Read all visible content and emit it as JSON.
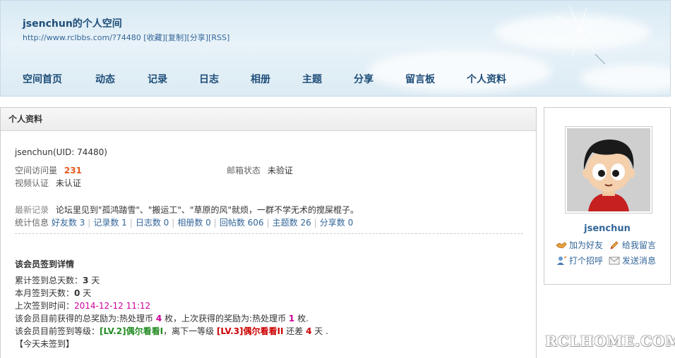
{
  "header": {
    "title": "jsenchun的个人空间",
    "url": "http://www.rclbbs.com/?74480",
    "links": [
      "[收藏]",
      "[复制]",
      "[分享]",
      "[RSS]"
    ]
  },
  "nav": [
    "空间首页",
    "动态",
    "记录",
    "日志",
    "相册",
    "主题",
    "分享",
    "留言板",
    "个人资料"
  ],
  "panel": {
    "title": "个人资料",
    "username": "jsenchun",
    "uid": "(UID: 74480)",
    "visits_label": "空间访问量",
    "visits_value": "231",
    "email_label": "邮箱状态",
    "email_value": "未验证",
    "video_label": "视频认证",
    "video_value": "未认证",
    "latest_label": "最新记录",
    "latest_text": "论坛里见到\"孤鸿踏雪\"、\"搬运工\"、\"草原的风\"就烦，一群不学无术的搅屎棍子。",
    "stats_label": "统计信息",
    "stats": [
      "好友数 3",
      "记录数 1",
      "日志数 0",
      "相册数 0",
      "回帖数 606",
      "主题数 26",
      "分享数 0"
    ],
    "checkin": {
      "heading": "该会员签到详情",
      "total_prefix": "累计签到总天数：",
      "total_days": "3",
      "total_suffix": " 天",
      "month_prefix": "本月签到天数：",
      "month_days": "0",
      "month_suffix": " 天",
      "last_prefix": "上次签到时间：",
      "last_time": "2014-12-12 11:12",
      "reward_a": "该会员目前获得的总奖励为:热处理币 ",
      "reward_total": "4",
      "reward_b": " 枚，上次获得的奖励为:热处理币 ",
      "reward_last": "1",
      "reward_c": " 枚.",
      "level_a": "该会员目前签到等级：",
      "level_current": "[LV.2]偶尔看看I",
      "level_b": "，离下一等级 ",
      "level_next": "[LV.3]偶尔看看II",
      "level_c": " 还差 ",
      "level_days": "4",
      "level_d": " 天 .",
      "today": "【今天未签到】"
    }
  },
  "side": {
    "username": "jsenchun",
    "actions": [
      "加为好友",
      "给我留言",
      "打个招呼",
      "发送消息"
    ]
  },
  "watermark": "RCLHOME.COM",
  "colors": {
    "link": "#336699",
    "visits": "#e45a1d",
    "time": "#cc0099",
    "lv_current": "#228b22",
    "lv_next": "#cc0000"
  }
}
